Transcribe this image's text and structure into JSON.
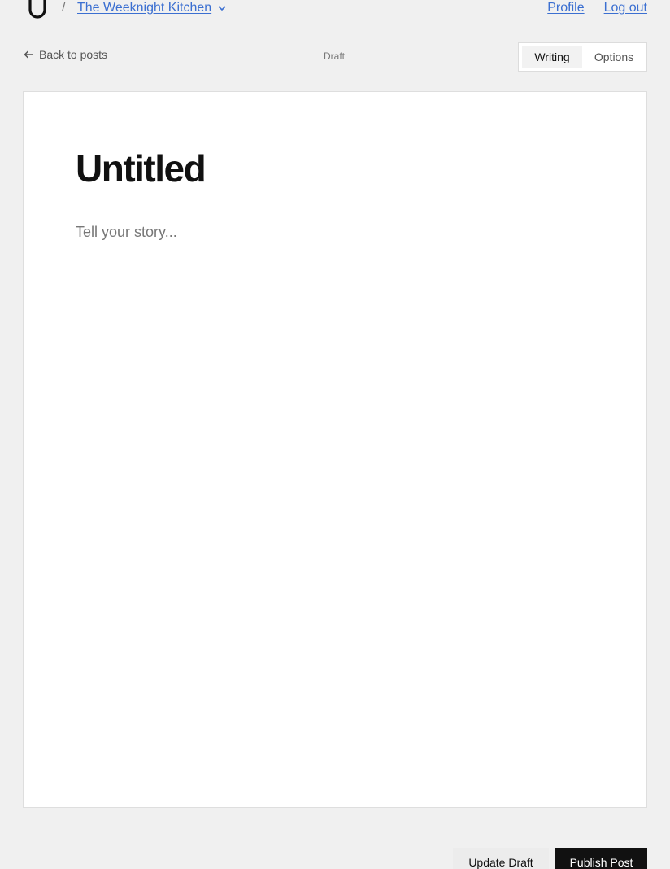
{
  "nav": {
    "breadcrumb_separator": "/",
    "site_name": "The Weeknight Kitchen",
    "profile_label": "Profile",
    "logout_label": "Log out"
  },
  "toolbar": {
    "back_label": "Back to posts",
    "status": "Draft",
    "modes": [
      {
        "label": "Writing",
        "active": true
      },
      {
        "label": "Options",
        "active": false
      }
    ]
  },
  "editor": {
    "title_placeholder": "Untitled",
    "body_placeholder": "Tell your story..."
  },
  "actions": {
    "update_label": "Update Draft",
    "publish_label": "Publish Post"
  },
  "colors": {
    "link": "#3b6fd1",
    "background": "#f0f0f0",
    "primary_button": "#111111"
  },
  "icons": {
    "logo": "logo-icon",
    "site_dropdown": "chevron-down-icon",
    "back": "arrow-left-icon"
  }
}
